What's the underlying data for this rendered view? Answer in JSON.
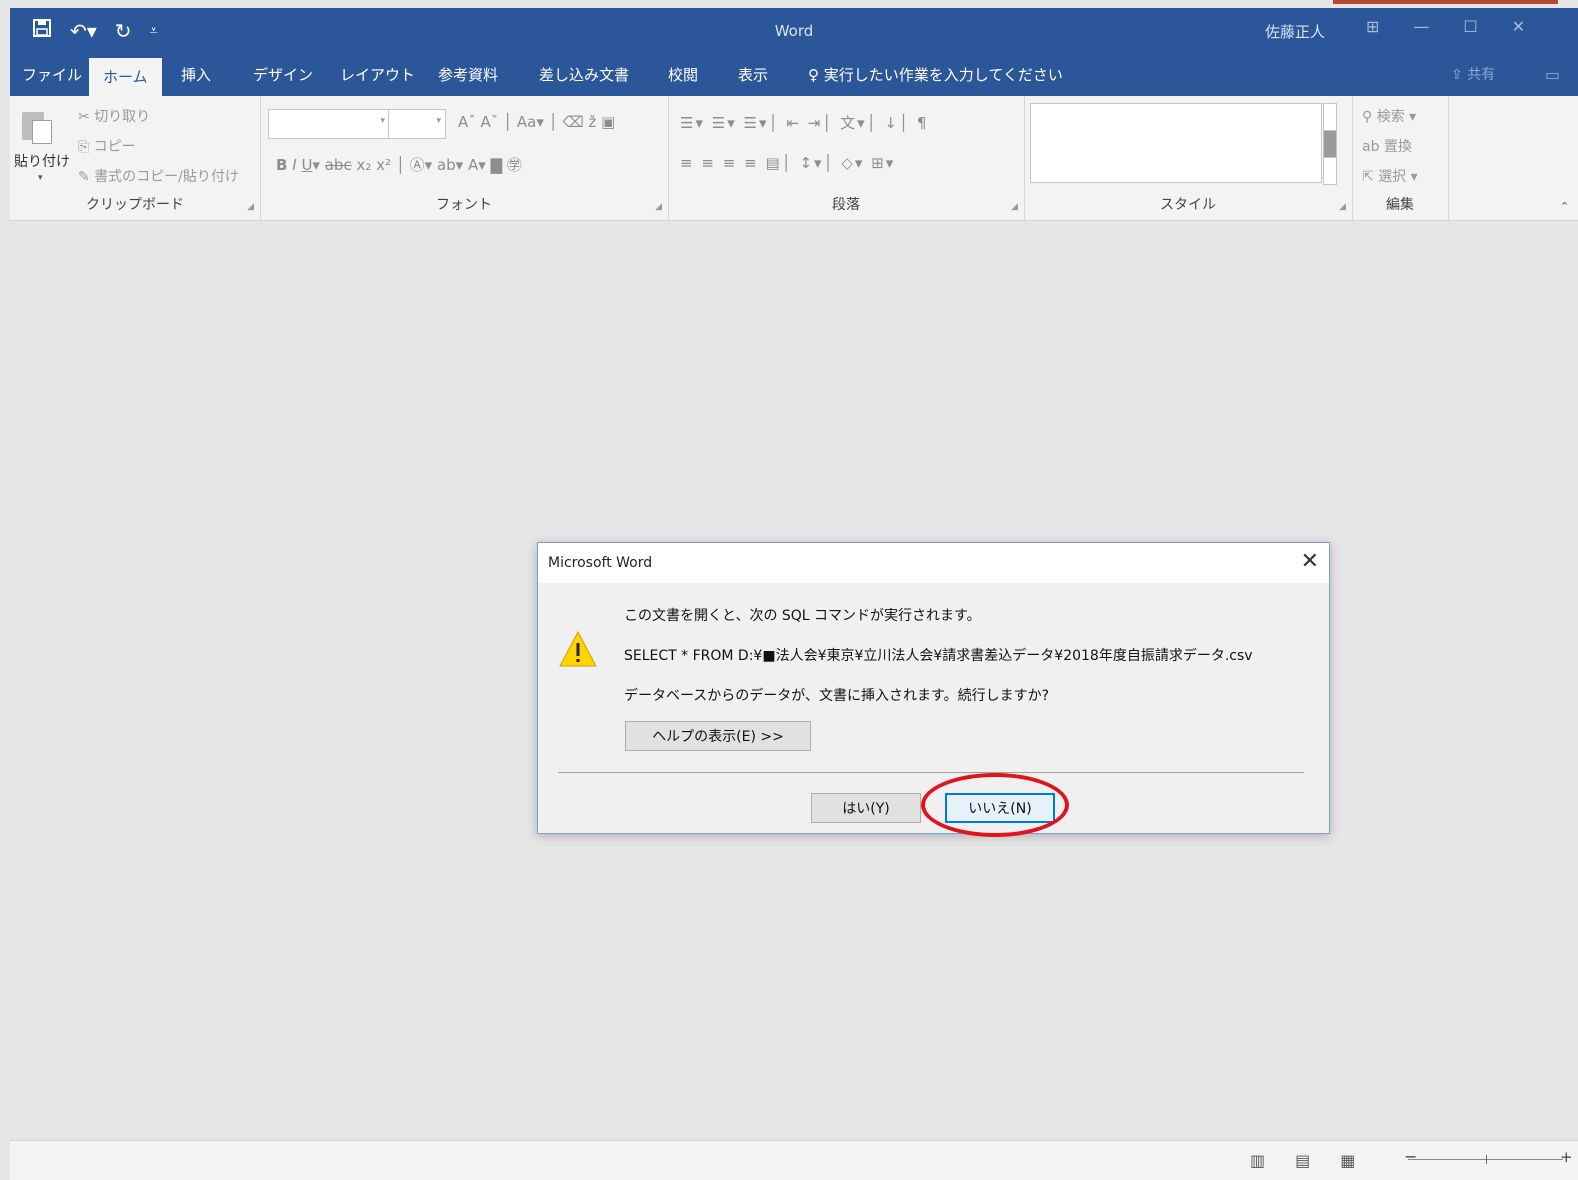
{
  "window": {
    "app_title": "Word",
    "user_name": "佐藤正人",
    "controls": [
      "⊞",
      "—",
      "☐",
      "✕"
    ]
  },
  "qat": {
    "save_icon": "save-icon",
    "undo_icon": "undo-icon",
    "redo_icon": "redo-icon",
    "customize": "customize-qat-icon"
  },
  "tabs": [
    "ファイル",
    "ホーム",
    "挿入",
    "デザイン",
    "レイアウト",
    "参考資料",
    "差し込み文書",
    "校閲",
    "表示"
  ],
  "active_tab": "ホーム",
  "tell_me": "実行したい作業を入力してください",
  "share": "共有",
  "ribbon": {
    "clipboard": {
      "label": "クリップボード",
      "paste": "貼り付け",
      "cut": "切り取り",
      "copy": "コピー",
      "format_painter": "書式のコピー/貼り付け"
    },
    "font": {
      "label": "フォント"
    },
    "paragraph": {
      "label": "段落"
    },
    "styles": {
      "label": "スタイル"
    },
    "editing": {
      "label": "編集",
      "find": "検索",
      "replace": "置換",
      "select": "選択"
    }
  },
  "dialog": {
    "title": "Microsoft Word",
    "line1": "この文書を開くと、次の SQL コマンドが実行されます。",
    "line2": "SELECT * FROM D:¥■法人会¥東京¥立川法人会¥請求書差込データ¥2018年度自振請求データ.csv",
    "line3": "データベースからのデータが、文書に挿入されます。続行しますか?",
    "help_button": "ヘルプの表示(E) >>",
    "yes_button": "はい(Y)",
    "no_button": "いいえ(N)"
  },
  "colors": {
    "brand": "#2b579a",
    "highlight": "#e2141b",
    "default_button_border": "#0078d7"
  }
}
